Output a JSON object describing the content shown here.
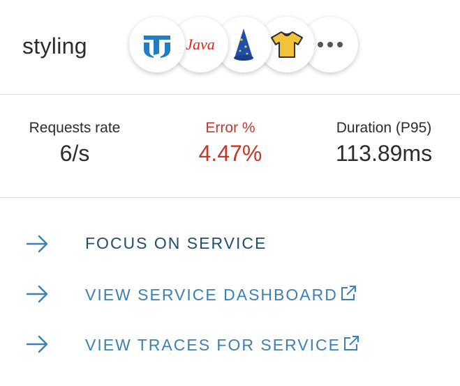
{
  "header": {
    "service_name": "styling",
    "tech_stack": [
      {
        "icon": "tidal-logo-icon",
        "color": "#1f7fc2"
      },
      {
        "icon": "java-logo-icon",
        "label": "Java",
        "color": "#e2231a"
      },
      {
        "icon": "wizard-hat-icon",
        "color": "#1f4fa8"
      },
      {
        "icon": "t-shirt-icon",
        "color": "#f2c23a"
      },
      {
        "icon": "more-icon"
      }
    ]
  },
  "metrics": {
    "requests": {
      "label": "Requests rate",
      "value": "6/s"
    },
    "error": {
      "label": "Error %",
      "value": "4.47%",
      "color": "#c0392b"
    },
    "duration": {
      "label": "Duration (P95)",
      "value": "113.89ms"
    }
  },
  "actions": [
    {
      "label": "FOCUS ON SERVICE",
      "icon": "arrow-right-icon",
      "external": false
    },
    {
      "label": "VIEW SERVICE DASHBOARD",
      "icon": "arrow-right-icon",
      "external": true
    },
    {
      "label": "VIEW TRACES FOR SERVICE",
      "icon": "arrow-right-icon",
      "external": true
    }
  ],
  "colors": {
    "link": "#3c7fb5",
    "link_primary": "#1f4d6e",
    "divider": "#dcdcdc"
  }
}
